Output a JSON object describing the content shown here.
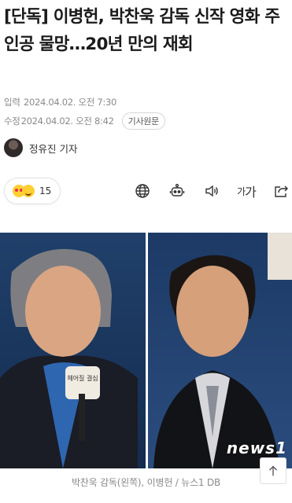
{
  "article": {
    "headline": "[단독] 이병헌, 박찬욱 감독 신작 영화 주인공 물망…20년 만의 재회",
    "input_label": "입력",
    "input_time": "2024.04.02. 오전 7:30",
    "modified_label": "수정",
    "modified_time": "2024.04.02. 오전 8:42",
    "source_button": "기사원문",
    "reporter": "정유진 기자"
  },
  "reactions": {
    "count": "15"
  },
  "toolbar": {
    "icons": [
      "globe-icon",
      "robot-summary-icon",
      "speaker-icon",
      "font-size-icon",
      "share-icon"
    ],
    "font_size_label_small": "가",
    "font_size_label_big": "가"
  },
  "photo": {
    "sign_text": "헤어질 결심",
    "watermark": "news1",
    "caption": "박찬욱 감독(왼쪽), 이병헌 / 뉴스1 DB"
  },
  "colors": {
    "text": "#1a1a1a",
    "meta": "#8a8a8a",
    "photo_bg": "#1e3558"
  }
}
